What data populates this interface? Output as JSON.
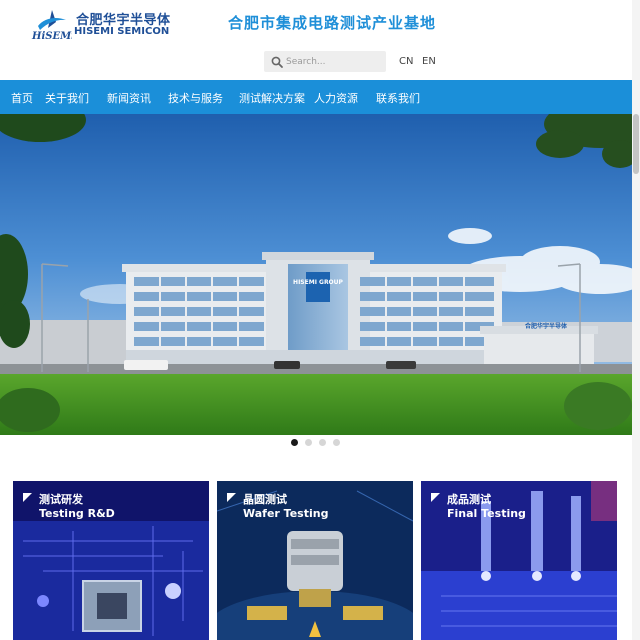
{
  "brand": {
    "name_cn": "合肥华宇半导体",
    "name_en": "HISEMI SEMICON",
    "mark_text": "HiSEMi",
    "slogan": "合肥市集成电路测试产业基地",
    "accent_color": "#1b8fd9",
    "logo_color": "#1f4f97"
  },
  "search": {
    "placeholder": "Search..."
  },
  "languages": [
    "CN",
    "EN"
  ],
  "nav": {
    "items": [
      {
        "label": "首页"
      },
      {
        "label": "关于我们"
      },
      {
        "label": "新闻资讯"
      },
      {
        "label": "技术与服务"
      },
      {
        "label": "测试解决方案"
      },
      {
        "label": "人力资源"
      },
      {
        "label": "联系我们"
      }
    ]
  },
  "banner": {
    "building_sign": "HISEMI GROUP",
    "gate_sign": "合肥华宇半导体",
    "slide_count": 4,
    "active_slide": 1
  },
  "services": [
    {
      "title_cn": "测试研发",
      "title_en": "Testing R&D"
    },
    {
      "title_cn": "晶圆测试",
      "title_en": "Wafer Testing"
    },
    {
      "title_cn": "成品测试",
      "title_en": "Final Testing"
    }
  ]
}
